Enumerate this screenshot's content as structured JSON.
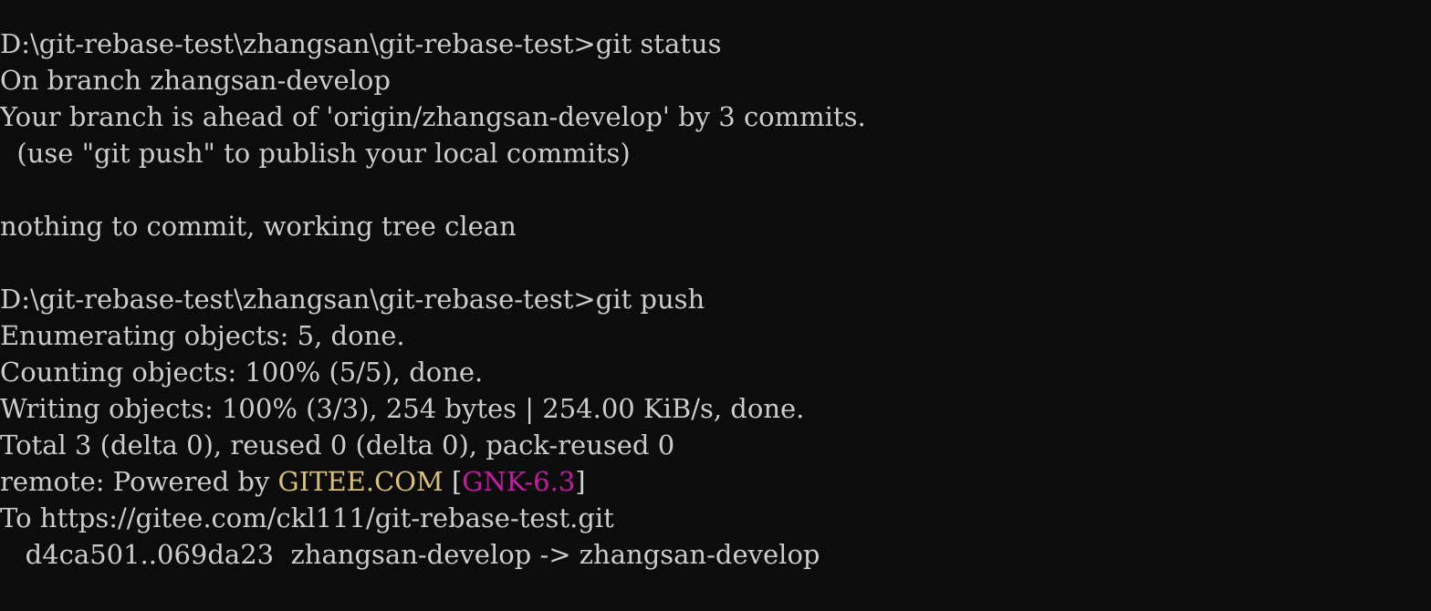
{
  "terminal": {
    "background_color": "#0c0c0c",
    "default_text_color": "#cccccc",
    "accent_colors": {
      "yellow": "#d8c07a",
      "magenta": "#c41ba0",
      "white": "#d4d4d4"
    },
    "prompt_path": "D:\\git-rebase-test\\zhangsan\\git-rebase-test>",
    "lines": [
      {
        "id": "prompt-git-status",
        "type": "prompt",
        "segments": [
          {
            "text": "D:\\git-rebase-test\\zhangsan\\git-rebase-test>git status",
            "color": "default"
          }
        ]
      },
      {
        "id": "on-branch",
        "type": "output",
        "segments": [
          {
            "text": "On branch zhangsan-develop",
            "color": "default"
          }
        ]
      },
      {
        "id": "branch-ahead",
        "type": "output",
        "segments": [
          {
            "text": "Your branch is ahead of 'origin/zhangsan-develop' by 3 commits.",
            "color": "default"
          }
        ]
      },
      {
        "id": "use-git-push-hint",
        "type": "output",
        "segments": [
          {
            "text": "  (use \"git push\" to publish your local commits)",
            "color": "default"
          }
        ]
      },
      {
        "id": "blank-1",
        "type": "blank",
        "segments": [
          {
            "text": " ",
            "color": "default"
          }
        ]
      },
      {
        "id": "nothing-to-commit",
        "type": "output",
        "segments": [
          {
            "text": "nothing to commit, working tree clean",
            "color": "default"
          }
        ]
      },
      {
        "id": "blank-2",
        "type": "blank",
        "segments": [
          {
            "text": " ",
            "color": "default"
          }
        ]
      },
      {
        "id": "prompt-git-push",
        "type": "prompt",
        "segments": [
          {
            "text": "D:\\git-rebase-test\\zhangsan\\git-rebase-test>git push",
            "color": "default"
          }
        ]
      },
      {
        "id": "enumerating-objects",
        "type": "output",
        "segments": [
          {
            "text": "Enumerating objects: 5, done.",
            "color": "default"
          }
        ]
      },
      {
        "id": "counting-objects",
        "type": "output",
        "segments": [
          {
            "text": "Counting objects: 100% (5/5), done.",
            "color": "default"
          }
        ]
      },
      {
        "id": "writing-objects",
        "type": "output",
        "segments": [
          {
            "text": "Writing objects: 100% (3/3), 254 bytes | 254.00 KiB/s, done.",
            "color": "default"
          }
        ]
      },
      {
        "id": "total-delta",
        "type": "output",
        "segments": [
          {
            "text": "Total 3 (delta 0), reused 0 (delta 0), pack-reused 0",
            "color": "default"
          }
        ]
      },
      {
        "id": "remote-powered-by",
        "type": "output",
        "segments": [
          {
            "text": "remote: Powered by ",
            "color": "default"
          },
          {
            "text": "GITEE.COM",
            "color": "yellow"
          },
          {
            "text": " ",
            "color": "default"
          },
          {
            "text": "[",
            "color": "white"
          },
          {
            "text": "GNK-6.3",
            "color": "magenta"
          },
          {
            "text": "]",
            "color": "white"
          }
        ]
      },
      {
        "id": "to-remote-url",
        "type": "output",
        "segments": [
          {
            "text": "To https://gitee.com/ckl111/git-rebase-test.git",
            "color": "default"
          }
        ]
      },
      {
        "id": "ref-update",
        "type": "output",
        "segments": [
          {
            "text": "   d4ca501..069da23  zhangsan-develop -> zhangsan-develop",
            "color": "default"
          }
        ]
      }
    ]
  }
}
